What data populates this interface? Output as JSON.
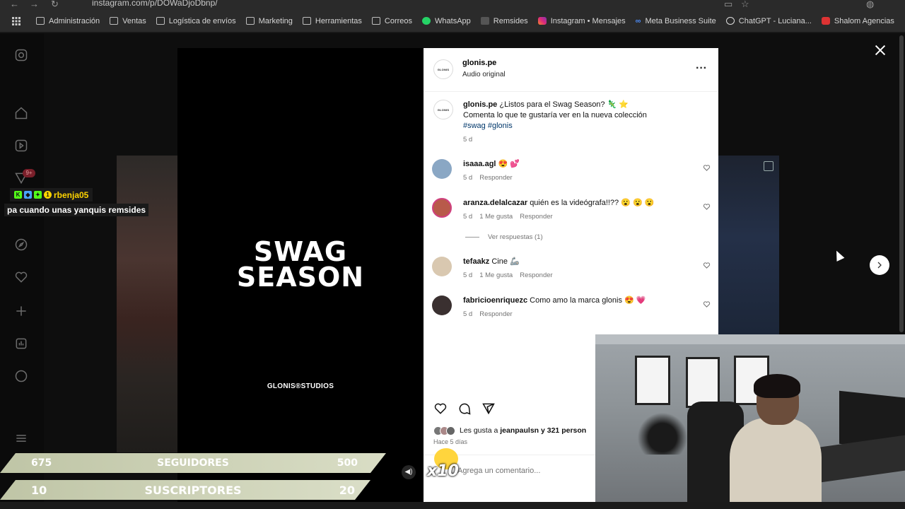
{
  "browser": {
    "url": "instagram.com/p/DOWaDjoDbnp/",
    "bookmarks": [
      {
        "label": "Administración",
        "icon": "folder-icon"
      },
      {
        "label": "Ventas",
        "icon": "folder-icon"
      },
      {
        "label": "Logística de envíos",
        "icon": "folder-icon"
      },
      {
        "label": "Marketing",
        "icon": "folder-icon"
      },
      {
        "label": "Herramientas",
        "icon": "folder-icon"
      },
      {
        "label": "Correos",
        "icon": "folder-icon"
      },
      {
        "label": "WhatsApp",
        "icon": "whatsapp-icon"
      },
      {
        "label": "Remsides",
        "icon": "remsides-icon"
      },
      {
        "label": "Instagram • Mensajes",
        "icon": "instagram-icon"
      },
      {
        "label": "Meta Business Suite",
        "icon": "meta-icon"
      },
      {
        "label": "ChatGPT - Luciana...",
        "icon": "chatgpt-icon"
      },
      {
        "label": "Shalom Agencias",
        "icon": "shalom-icon"
      }
    ]
  },
  "sidebar": {
    "notification_badge": "9+"
  },
  "post": {
    "media_title": "SWAG SEASON",
    "media_footer": "GLONIS®STUDIOS",
    "author": "glonis.pe",
    "audio": "Audio original",
    "logo_text": "GLONIS",
    "caption": {
      "user": "glonis.pe",
      "text": "¿Listos para el Swag Season? 🦎 ⭐",
      "line2": "Comenta lo que te gustaría ver en la nueva colección",
      "tags": "#swag #glonis",
      "time": "5 d"
    },
    "comments": [
      {
        "user": "isaaa.agl",
        "text": "😍 💕",
        "time": "5 d",
        "likes": "",
        "reply": "Responder",
        "avatar_color": "#8aa7c4"
      },
      {
        "user": "aranza.delalcazar",
        "text": "quién es la videógrafa!!?? 😮 😮 😮",
        "time": "5 d",
        "likes": "1 Me gusta",
        "reply": "Responder",
        "avatar_color": "#b85a4a"
      },
      {
        "user": "tefaakz",
        "text": "Cine 🦾",
        "time": "5 d",
        "likes": "1 Me gusta",
        "reply": "Responder",
        "avatar_color": "#d9c8b0"
      },
      {
        "user": "fabricioenriquezc",
        "text": "Como amo la marca glonis 😍 💗",
        "time": "5 d",
        "likes": "",
        "reply": "Responder",
        "avatar_color": "#3a3030"
      }
    ],
    "view_replies": "Ver respuestas (1)",
    "likes_text": "Les gusta a",
    "likes_user": "jeanpaulsn",
    "likes_rest": "y 321 person",
    "posted": "Hace 5 días",
    "add_comment": "Agrega un comentario..."
  },
  "stream": {
    "chat_user": "rbenja05",
    "chat_message": "pa cuando unas yanquis remsides",
    "followers": {
      "current": "675",
      "label": "SEGUIDORES",
      "goal": "500"
    },
    "subscribers": {
      "current": "10",
      "label": "SUSCRIPTORES",
      "goal": "20"
    },
    "emote_multiplier": "x10"
  }
}
